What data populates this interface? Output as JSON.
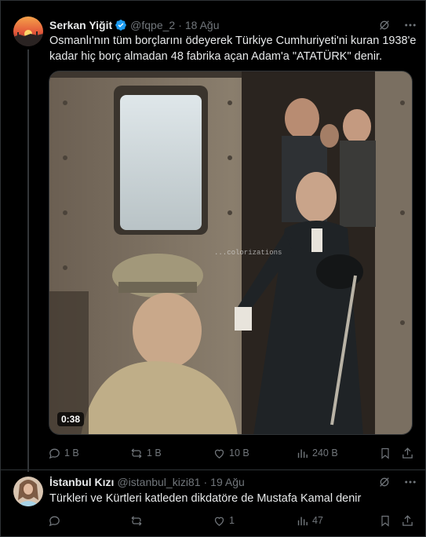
{
  "tweet1": {
    "name": "Serkan Yiğit",
    "handle": "@fqpe_2",
    "separator": "·",
    "date": "18 Ağu",
    "text": "Osmanlı'nın tüm borçlarını ödeyerek Türkiye Cumhuriyeti'ni kuran 1938'e kadar hiç borç almadan 48 fabrika açan Adam'a \"ATATÜRK\" denir.",
    "video_duration": "0:38",
    "video_watermark": "...colorizations",
    "reply_count": "1 B",
    "retweet_count": "1 B",
    "like_count": "10 B",
    "view_count": "240 B"
  },
  "tweet2": {
    "name": "İstanbul Kızı",
    "handle": "@istanbul_kizi81",
    "separator": "·",
    "date": "19 Ağu",
    "text": "Türkleri ve Kürtleri katleden dikdatöre de Mustafa Kamal denir",
    "reply_count": "",
    "retweet_count": "",
    "like_count": "1",
    "view_count": "47"
  },
  "colors": {
    "background": "#000000",
    "text_primary": "#e7e9ea",
    "text_secondary": "#71767b",
    "verified": "#1d9bf0",
    "border": "#2f3336"
  },
  "icons": [
    "verified-badge-icon",
    "grok-icon",
    "more-icon",
    "reply-icon",
    "retweet-icon",
    "like-icon",
    "views-icon",
    "bookmark-icon",
    "share-icon"
  ]
}
